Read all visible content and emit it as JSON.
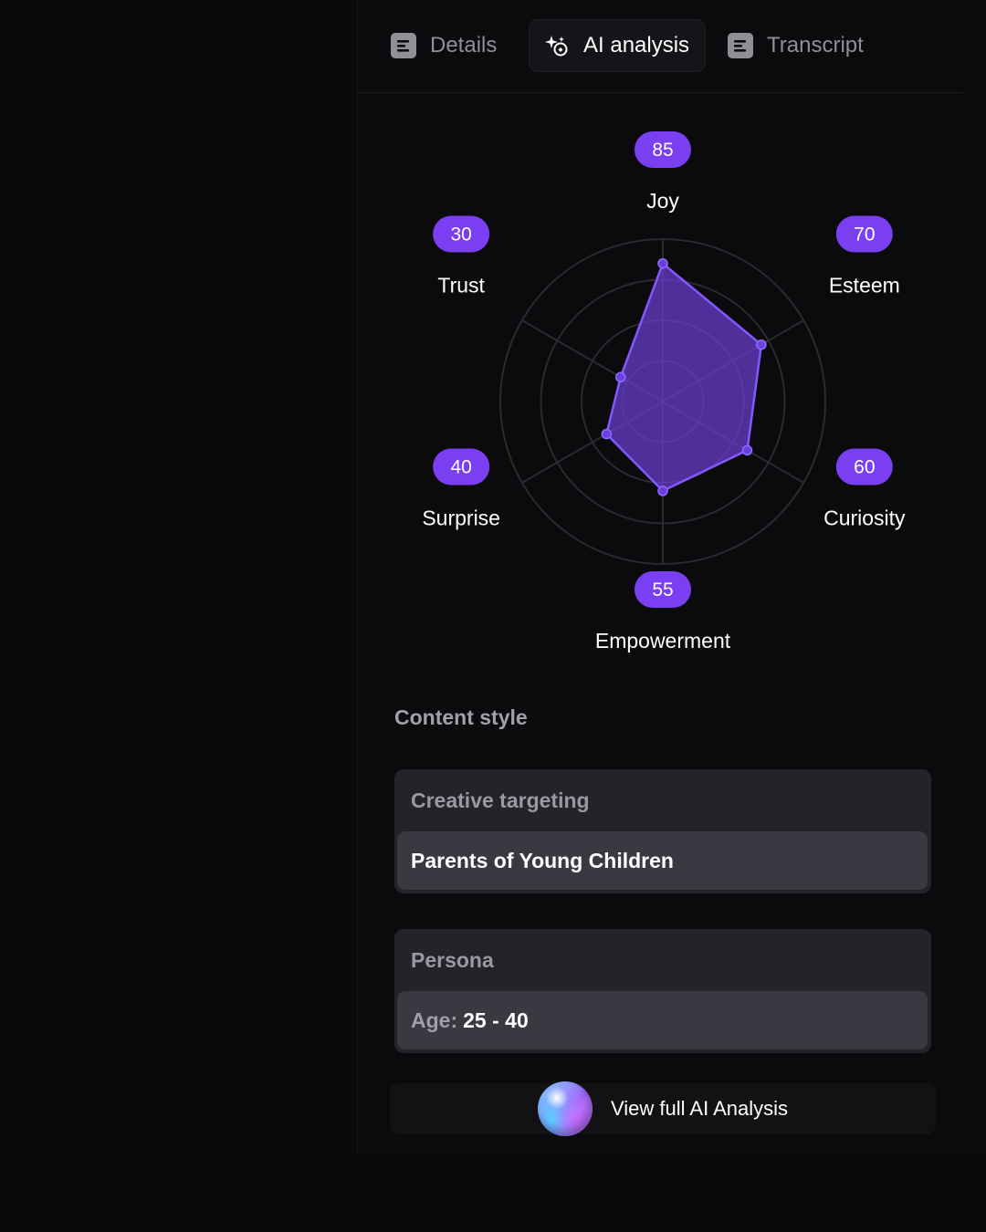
{
  "tabs": [
    {
      "label": "Details",
      "icon": "document-icon",
      "active": false
    },
    {
      "label": "AI analysis",
      "icon": "sparkle-icon",
      "active": true
    },
    {
      "label": "Transcript",
      "icon": "document-icon",
      "active": false
    }
  ],
  "chart_data": {
    "type": "radar",
    "categories": [
      "Joy",
      "Esteem",
      "Curiosity",
      "Empowerment",
      "Surprise",
      "Trust"
    ],
    "values": [
      85,
      70,
      60,
      55,
      40,
      30
    ],
    "rmax": 100,
    "rings": 4,
    "series_color": "#6a3fd1",
    "badge_color": "#7b3ff2"
  },
  "content_style": {
    "title": "Content style",
    "creative_targeting": {
      "label": "Creative targeting",
      "value": "Parents of Young Children"
    },
    "persona": {
      "label": "Persona",
      "age_label": "Age:",
      "age_value": "25 - 40"
    }
  },
  "cta": {
    "label": "View full AI Analysis",
    "icon": "ai-orb-icon"
  }
}
